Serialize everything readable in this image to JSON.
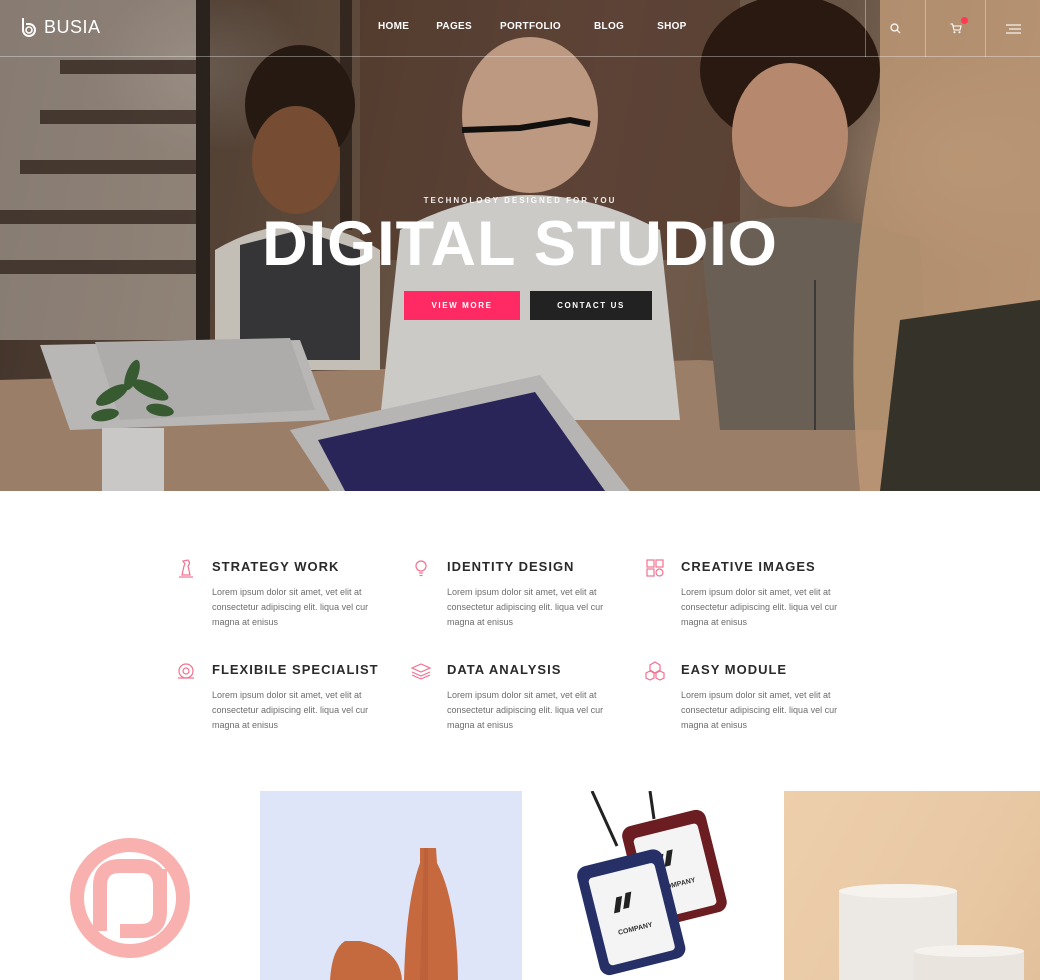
{
  "brand": {
    "name": "BUSIA"
  },
  "nav": {
    "items": [
      {
        "label": "HOME"
      },
      {
        "label": "PAGES"
      },
      {
        "label": "PORTFOLIO"
      },
      {
        "label": "BLOG"
      },
      {
        "label": "SHOP"
      }
    ],
    "icons": [
      "search-icon",
      "cart-icon",
      "menu-icon"
    ]
  },
  "hero": {
    "tagline": "TECHNOLOGY DESIGNED FOR YOU",
    "headline": "DIGITAL STUDIO",
    "primary_button": "VIEW MORE",
    "secondary_button": "CONTACT US"
  },
  "features": [
    {
      "icon": "chess-piece-icon",
      "title": "STRATEGY WORK",
      "text": "Lorem ipsum dolor sit amet, vet elit at consectetur adipiscing elit. liqua vel cur magna at enisus"
    },
    {
      "icon": "lightbulb-icon",
      "title": "IDENTITY DESIGN",
      "text": "Lorem ipsum dolor sit amet, vet elit at consectetur adipiscing elit. liqua vel cur magna at enisus"
    },
    {
      "icon": "puzzle-icon",
      "title": "CREATIVE IMAGES",
      "text": "Lorem ipsum dolor sit amet, vet elit at consectetur adipiscing elit. liqua vel cur magna at enisus"
    },
    {
      "icon": "target-icon",
      "title": "FLEXIBILE SPECIALIST",
      "text": "Lorem ipsum dolor sit amet, vet elit at consectetur adipiscing elit. liqua vel cur magna at enisus"
    },
    {
      "icon": "layers-icon",
      "title": "DATA ANALYSIS",
      "text": "Lorem ipsum dolor sit amet, vet elit at consectetur adipiscing elit. liqua vel cur magna at enisus"
    },
    {
      "icon": "cubes-icon",
      "title": "EASY MODULE",
      "text": "Lorem ipsum dolor sit amet, vet elit at consectetur adipiscing elit. liqua vel cur magna at enisus"
    }
  ],
  "portfolio": {
    "badge_text": "COMPANY"
  },
  "colors": {
    "accent": "#ff2a64",
    "dark": "#222222",
    "icon_pink": "#f3708f"
  }
}
